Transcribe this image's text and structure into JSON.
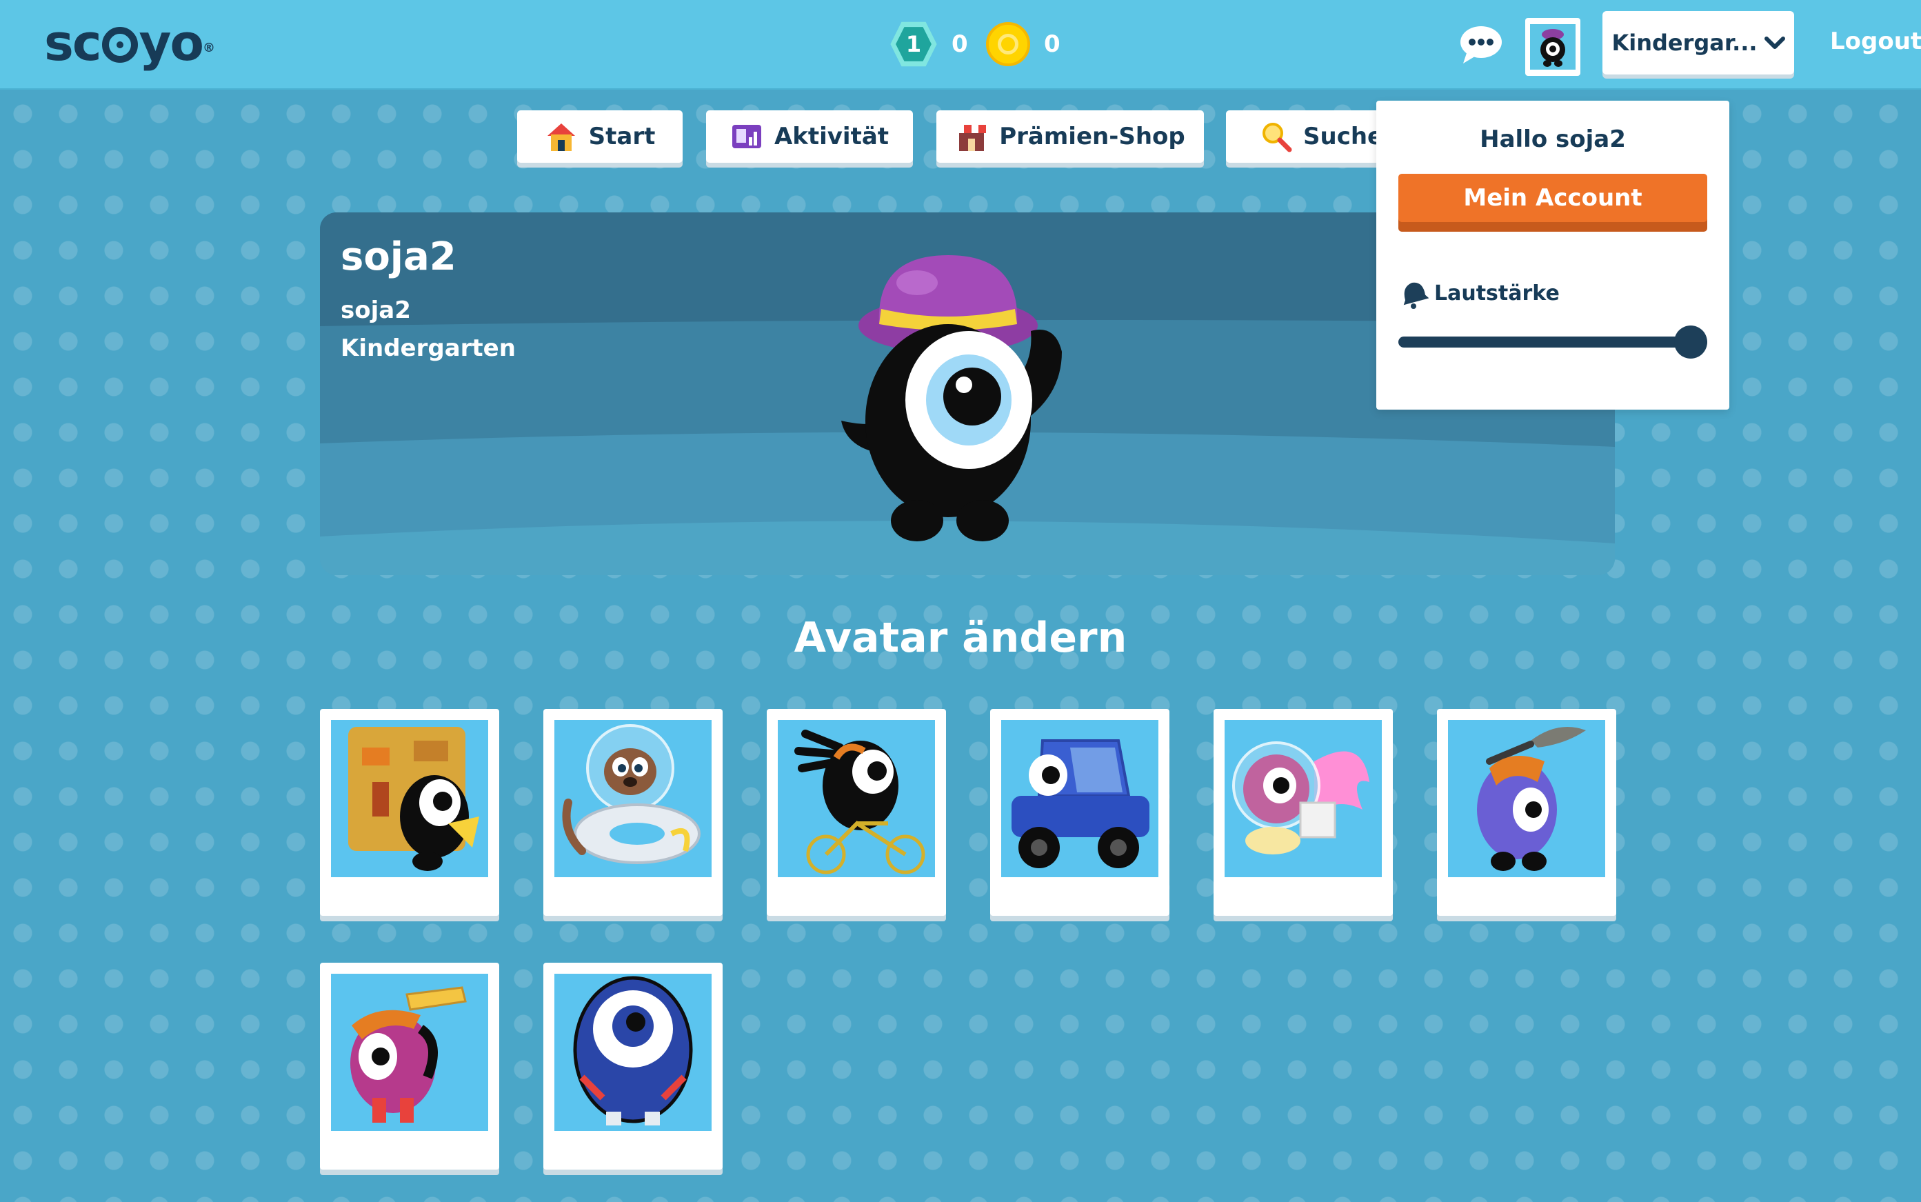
{
  "header": {
    "logo_prefix": "sc",
    "logo_suffix": "yo",
    "logo_mark": "®",
    "gems": {
      "icon": "hexagon-level-icon",
      "level": "1",
      "value": "0"
    },
    "coins": {
      "icon": "coin-icon",
      "value": "0"
    },
    "chat_icon": "chat-bubble-icon",
    "avatar_icon": "avatar-thumbnail",
    "level_select": "Kindergar...",
    "logout": "Logout"
  },
  "nav": [
    {
      "label": "Start",
      "icon": "house-icon"
    },
    {
      "label": "Aktivität",
      "icon": "activity-icon"
    },
    {
      "label": "Prämien-Shop",
      "icon": "shop-icon"
    },
    {
      "label": "Suchen",
      "icon": "magnifier-icon"
    }
  ],
  "profile": {
    "name": "soja2",
    "username": "soja2",
    "grade": "Kindergarten"
  },
  "section_title": "Avatar ändern",
  "avatars": [
    {
      "name": "avatar-adventurer"
    },
    {
      "name": "avatar-astronaut-dog"
    },
    {
      "name": "avatar-cyclist"
    },
    {
      "name": "avatar-car"
    },
    {
      "name": "avatar-space-pink"
    },
    {
      "name": "avatar-warrior"
    },
    {
      "name": "avatar-book-carrier"
    },
    {
      "name": "avatar-superhero"
    }
  ],
  "dropdown": {
    "greeting": "Hallo soja2",
    "account_button": "Mein Account",
    "volume_label": "Lautstärke",
    "volume_level": 1.0
  },
  "colors": {
    "topbar": "#5dc6e6",
    "background": "#4aa6c8",
    "accent_orange": "#ef7328",
    "text_dark": "#173b57"
  }
}
